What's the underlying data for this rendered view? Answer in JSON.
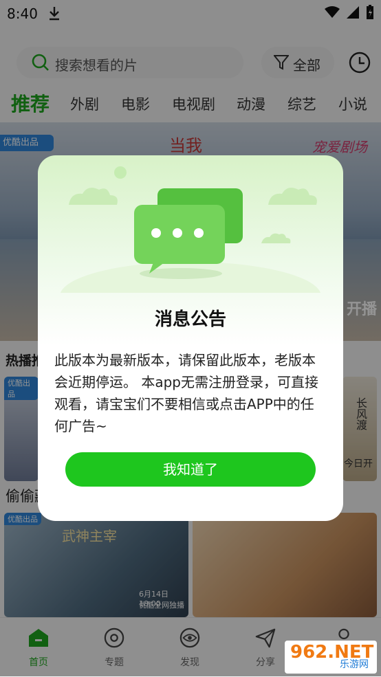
{
  "status_bar": {
    "time": "8:40"
  },
  "search": {
    "placeholder": "搜索想看的片"
  },
  "filter": {
    "label": "全部"
  },
  "tabs": [
    {
      "label": "推荐",
      "active": true
    },
    {
      "label": "外剧"
    },
    {
      "label": "电影"
    },
    {
      "label": "电视剧"
    },
    {
      "label": "动漫"
    },
    {
      "label": "综艺"
    },
    {
      "label": "小说"
    }
  ],
  "banner": {
    "badge": "优酷出品",
    "title_mid": "当我",
    "title_right": "宠爱剧场",
    "tag": "开播"
  },
  "sections": [
    {
      "title": "热播推"
    },
    {
      "title": "偷偷藏"
    }
  ],
  "cards": {
    "row1_left_tag": "优酷出品",
    "row1_right_title": "长风渡",
    "row1_right_note": "今日开",
    "row2_left_tag": "优酷出品",
    "row2_left_title": "武神主宰",
    "row2_left_note": "6月14日18:00",
    "row2_left_sub": "优酷全网独播"
  },
  "bottom_nav": [
    {
      "label": "首页",
      "icon": "home-icon",
      "active": true
    },
    {
      "label": "专题",
      "icon": "disc-icon"
    },
    {
      "label": "发现",
      "icon": "eye-icon"
    },
    {
      "label": "分享",
      "icon": "send-icon"
    },
    {
      "label": "",
      "icon": "user-icon"
    }
  ],
  "modal": {
    "title": "消息公告",
    "body": "此版本为最新版本，请保留此版本，老版本会近期停运。 本app无需注册登录，可直接观看，请宝宝们不要相信或点击APP中的任何广告~",
    "button": "我知道了"
  },
  "watermark": {
    "top": "962.NET",
    "bottom": "乐游网"
  },
  "colors": {
    "accent": "#1ec61e",
    "tab_active": "#1ea51e"
  }
}
